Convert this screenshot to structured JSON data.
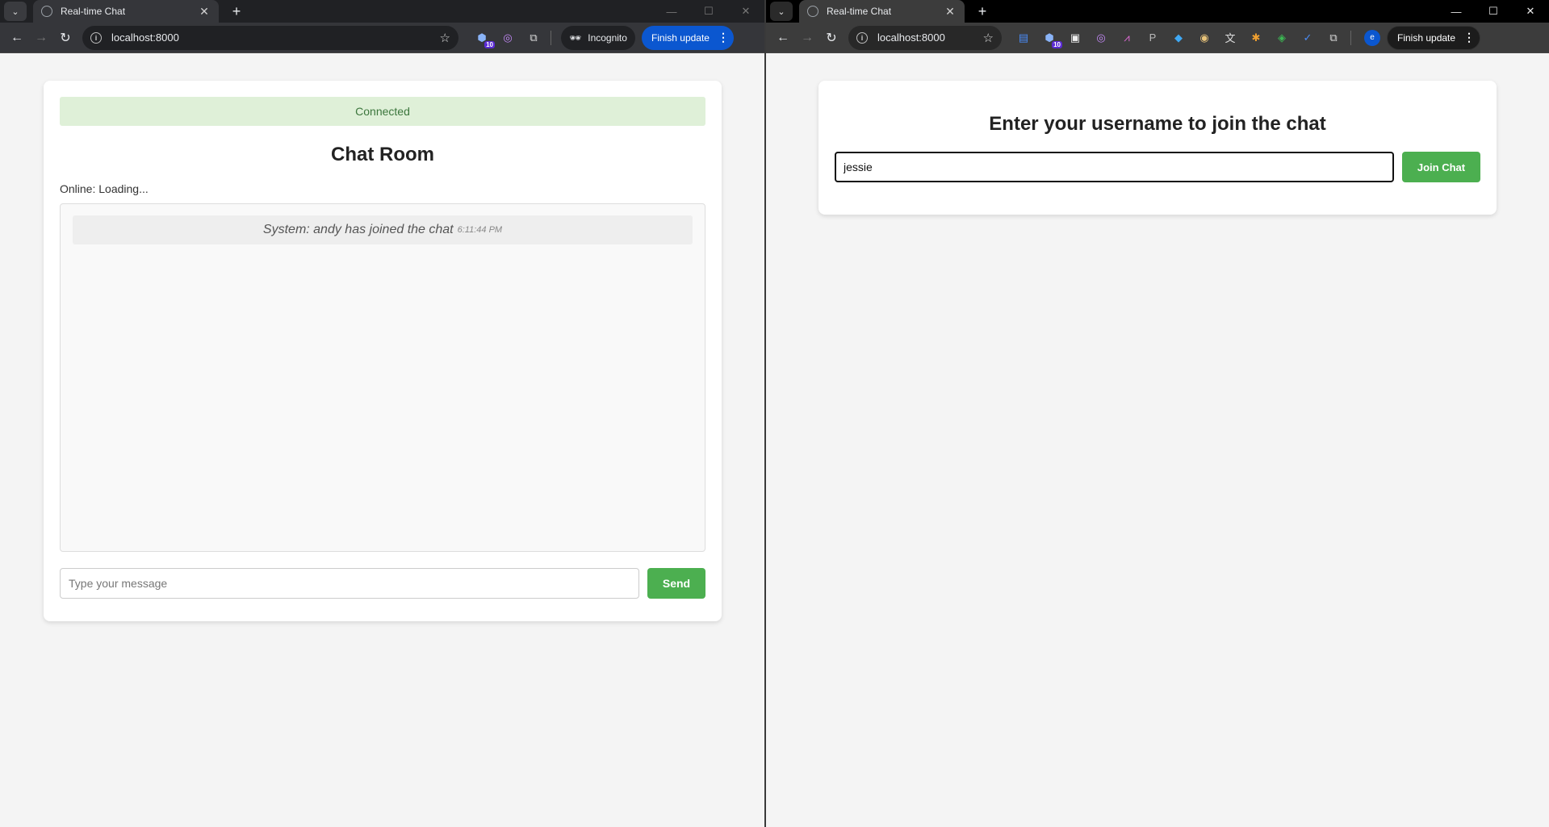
{
  "left_browser": {
    "tab_title": "Real-time Chat",
    "url": "localhost:8000",
    "incognito_label": "Incognito",
    "finish_update_label": "Finish update",
    "extension_badge": "10"
  },
  "right_browser": {
    "tab_title": "Real-time Chat",
    "url": "localhost:8000",
    "finish_update_label": "Finish update",
    "extension_badge": "10",
    "profile_initial": "e"
  },
  "chat": {
    "status": "Connected",
    "title": "Chat Room",
    "online": "Online: Loading...",
    "messages": [
      {
        "text": "System: andy has joined the chat",
        "time": "6:11:44 PM"
      }
    ],
    "input_placeholder": "Type your message",
    "send_label": "Send"
  },
  "join": {
    "title": "Enter your username to join the chat",
    "username_value": "jessie",
    "join_label": "Join Chat"
  },
  "colors": {
    "accent_green": "#4caf50",
    "status_bg": "#dff0d8",
    "status_text": "#3c763d",
    "finish_update_blue": "#0b57d0"
  }
}
